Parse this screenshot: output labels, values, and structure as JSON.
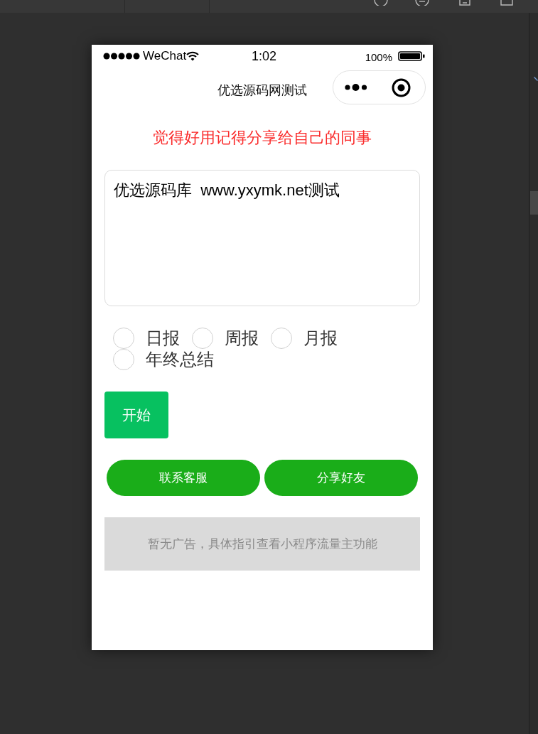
{
  "status_bar": {
    "carrier": "WeChat",
    "time": "1:02",
    "battery": "100%"
  },
  "nav_bar": {
    "title": "优选源码网测试"
  },
  "banner": "觉得好用记得分享给自己的同事",
  "text_area": {
    "value": "优选源码库  www.yxymk.net测试"
  },
  "report_types": [
    {
      "label": "日报",
      "selected": false
    },
    {
      "label": "周报",
      "selected": false
    },
    {
      "label": "月报",
      "selected": false
    },
    {
      "label": "年终总结",
      "selected": false
    }
  ],
  "start_button": "开始",
  "buttons": [
    "联系客服",
    "分享好友"
  ],
  "ad_notice": "暂无广告，具体指引查看小程序流量主功能"
}
